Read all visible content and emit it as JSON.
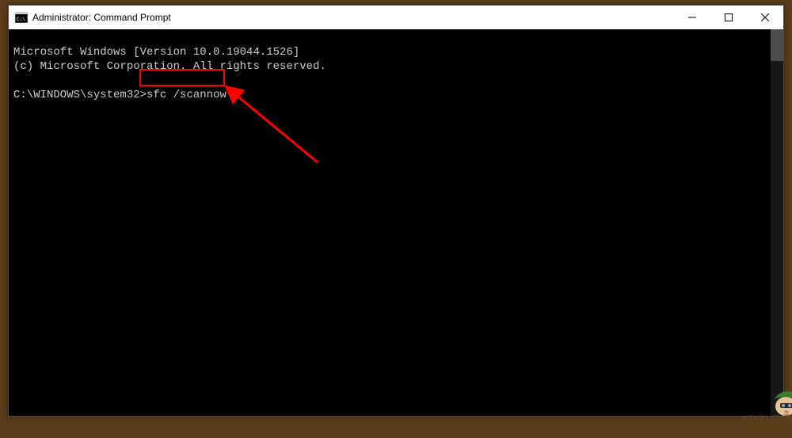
{
  "titlebar": {
    "title": "Administrator: Command Prompt"
  },
  "terminal": {
    "line1": "Microsoft Windows [Version 10.0.19044.1526]",
    "line2": "(c) Microsoft Corporation. All rights reserved.",
    "prompt": "C:\\WINDOWS\\system32>",
    "command": "sfc /scannow"
  },
  "watermark": "wsxdn.com"
}
